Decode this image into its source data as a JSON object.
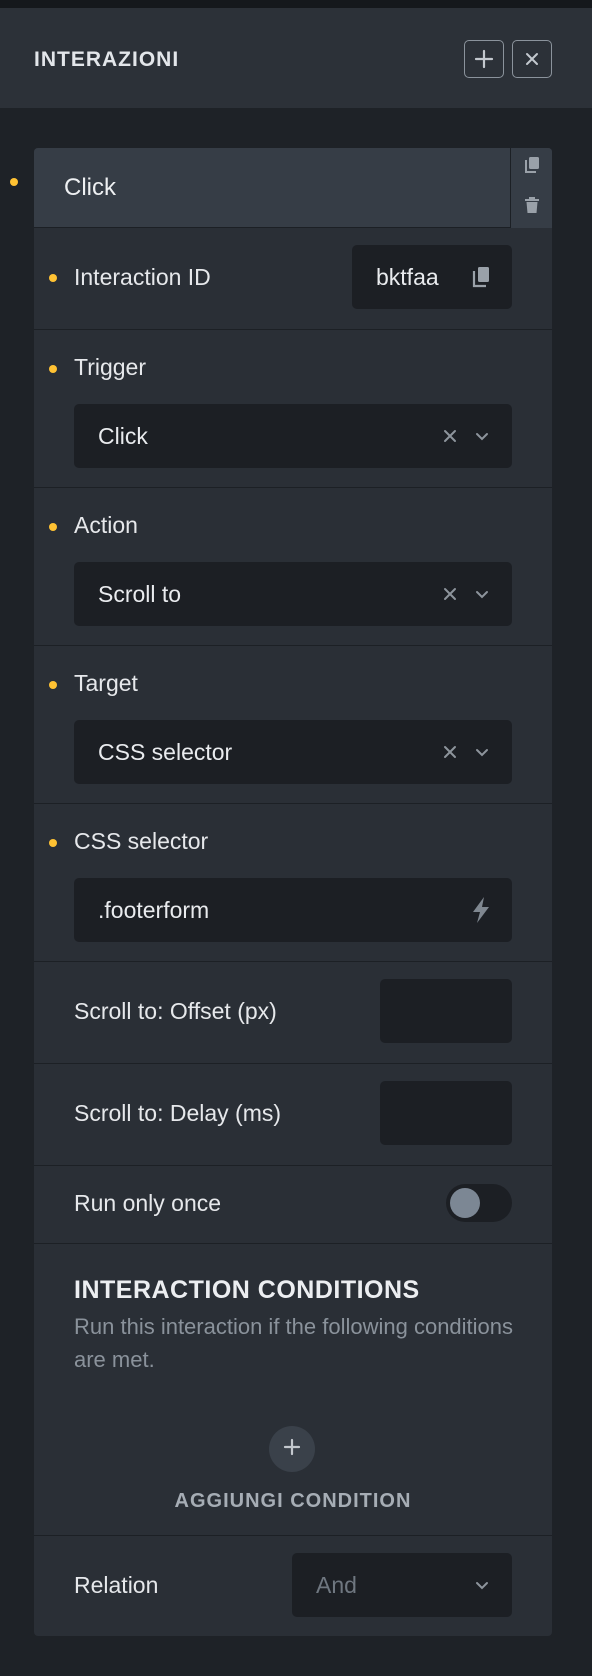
{
  "panel": {
    "title": "INTERAZIONI",
    "add_icon": "plus-icon",
    "close_icon": "close-icon"
  },
  "interaction": {
    "name": "Click",
    "tools": [
      "copy-icon",
      "trash-icon"
    ],
    "fields": {
      "interaction_id": {
        "label": "Interaction ID",
        "value": "bktfaa"
      },
      "trigger": {
        "label": "Trigger",
        "value": "Click"
      },
      "action": {
        "label": "Action",
        "value": "Scroll to"
      },
      "target": {
        "label": "Target",
        "value": "CSS selector"
      },
      "css_selector": {
        "label": "CSS selector",
        "value": ".footerform"
      },
      "offset": {
        "label": "Scroll to: Offset (px)",
        "value": ""
      },
      "delay": {
        "label": "Scroll to: Delay (ms)",
        "value": ""
      },
      "run_once": {
        "label": "Run only once",
        "enabled": false
      }
    },
    "conditions": {
      "title": "INTERACTION CONDITIONS",
      "description": "Run this interaction if the following conditions are met.",
      "add_label": "AGGIUNGI CONDITION"
    },
    "relation": {
      "label": "Relation",
      "value": "And"
    }
  },
  "colors": {
    "accent_dot": "#ffc233",
    "panel_bg": "#2a2f36",
    "header_bg": "#2c3138",
    "input_bg": "#1c1f24"
  }
}
